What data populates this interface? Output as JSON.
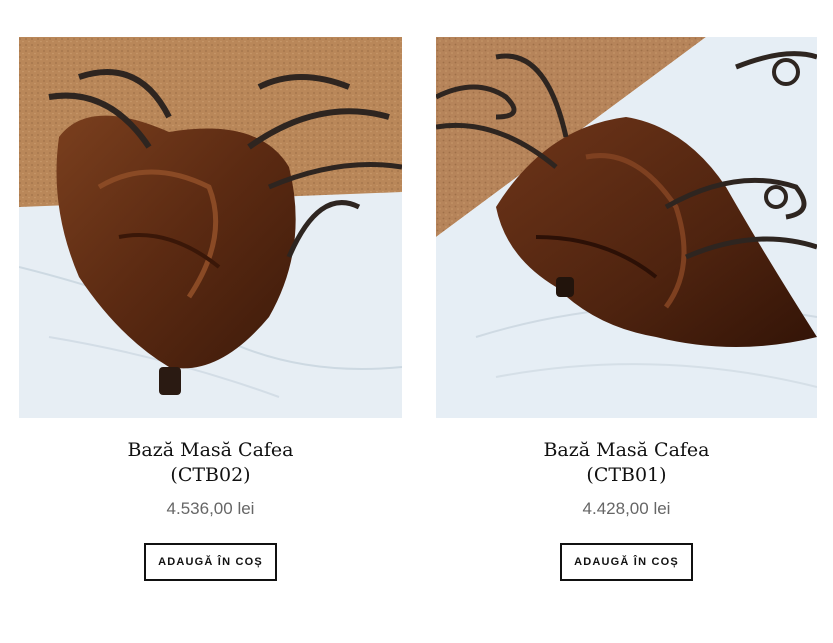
{
  "products": [
    {
      "title_line1": "Bază Masă Cafea",
      "title_line2": "(CTB02)",
      "price": "4.536,00 lei",
      "add_to_cart": "ADAUGĂ ÎN COȘ",
      "image_icon": "product-photo-driftwood-table-base"
    },
    {
      "title_line1": "Bază Masă Cafea",
      "title_line2": "(CTB01)",
      "price": "4.428,00 lei",
      "add_to_cart": "ADAUGĂ ÎN COȘ",
      "image_icon": "product-photo-driftwood-table-base"
    }
  ],
  "colors": {
    "wall": "#b8865c",
    "cloth": "#e6eef4",
    "wood": "#5a2c14",
    "iron": "#2e2520"
  }
}
